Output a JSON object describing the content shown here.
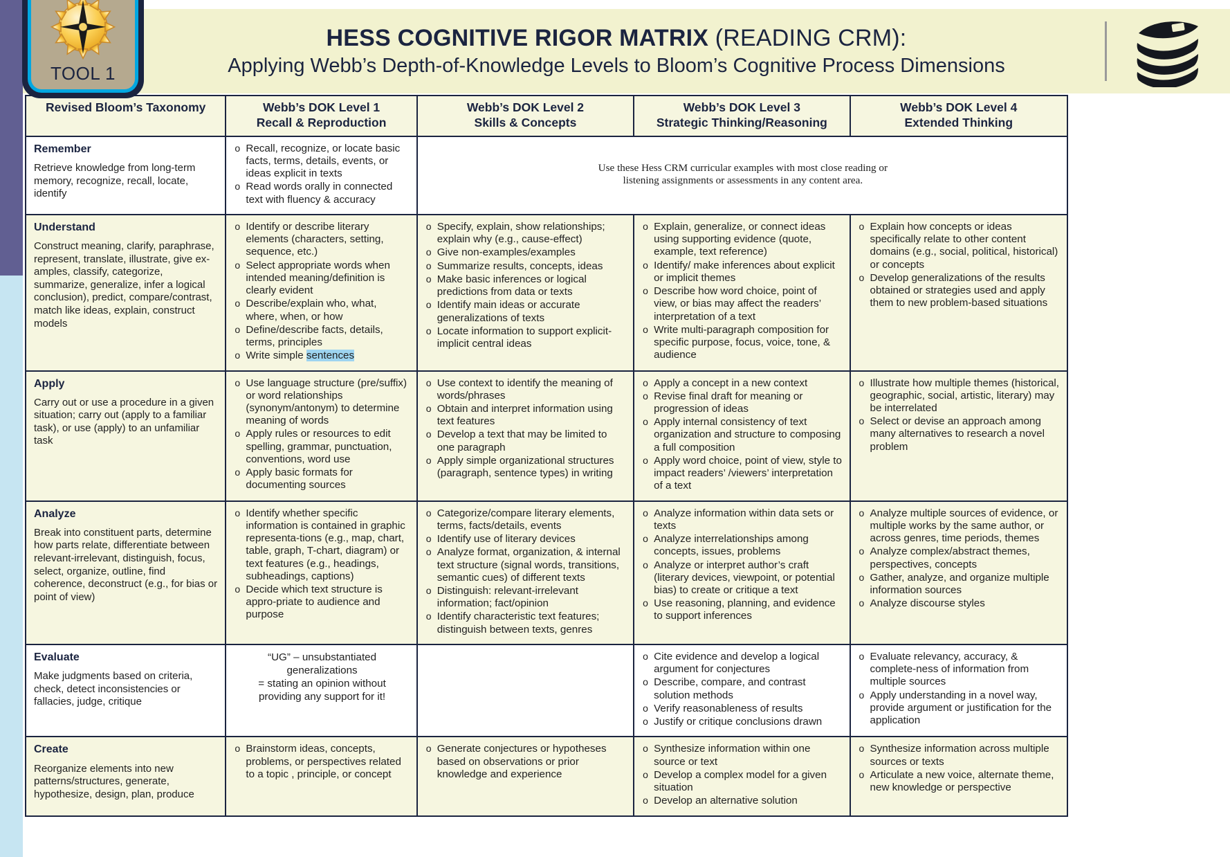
{
  "badge": {
    "label": "TOOL 1",
    "icon": "compass-icon"
  },
  "header": {
    "title_bold": "HESS COGNITIVE RIGOR MATRIX ",
    "title_light": "(READING CRM):",
    "subtitle": "Applying Webb’s Depth-of-Knowledge Levels to Bloom’s Cognitive Process Dimensions",
    "icon": "book-stack-icon",
    "bg_color": "#f2f2cf",
    "text_color": "#1b2440"
  },
  "columns": [
    {
      "title": "Revised Bloom’s Taxonomy",
      "sub": ""
    },
    {
      "title": "Webb’s DOK Level 1",
      "sub": "Recall & Reproduction"
    },
    {
      "title": "Webb’s DOK Level 2",
      "sub": "Skills & Concepts"
    },
    {
      "title": "Webb’s DOK Level 3",
      "sub": "Strategic Thinking/Reasoning"
    },
    {
      "title": "Webb’s DOK Level 4",
      "sub": "Extended Thinking"
    }
  ],
  "banner": {
    "line1": "Use these Hess CRM curricular examples with most close reading or",
    "line2": "listening assignments or assessments in any content area.",
    "bg_color": "#fbe97a"
  },
  "rows": {
    "remember": {
      "name": "Remember",
      "desc": "Retrieve knowledge from long-term memory, recognize, recall, locate, identify",
      "dok1": [
        "Recall, recognize, or locate basic facts, terms, details, events, or ideas explicit in texts",
        "Read words orally in connected text with fluency & accuracy"
      ]
    },
    "understand": {
      "name": "Understand",
      "desc": "Construct meaning, clarify, paraphrase, represent, translate, illustrate, give ex-amples, classify, categorize, summarize, generalize, infer a logical conclusion), predict, compare/contrast, match like ideas, explain, construct models",
      "dok1": [
        "Identify or describe literary elements (characters, setting, sequence, etc.)",
        "Select appropriate words when intended meaning/definition is clearly evident",
        "Describe/explain who, what, where, when, or how",
        "Define/describe facts, details, terms, principles",
        "Write simple sentences"
      ],
      "dok1_highlight": "sentences",
      "dok2": [
        "Specify, explain, show relationships; explain why (e.g., cause-effect)",
        "Give non-examples/examples",
        "Summarize results, concepts, ideas",
        "Make basic inferences or logical predictions from data or texts",
        "Identify main ideas or accurate generalizations of texts",
        "Locate information to support explicit-implicit central ideas"
      ],
      "dok3": [
        "Explain, generalize, or connect ideas using supporting evidence (quote, example, text reference)",
        "Identify/ make inferences about explicit or implicit themes",
        "Describe how  word choice, point of view, or bias may affect the readers’ interpretation of a text",
        "Write multi-paragraph  composition for specific purpose, focus, voice, tone, & audience"
      ],
      "dok4": [
        "Explain how concepts or ideas specifically relate to other content domains (e.g., social, political, historical) or concepts",
        "Develop generalizations of the results obtained or strategies used and apply them to new problem-based situations"
      ]
    },
    "apply": {
      "name": "Apply",
      "desc": "Carry out or use a procedure in a given situation; carry out (apply to a familiar task), or use (apply) to an unfamiliar task",
      "dok1": [
        "Use language structure (pre/suffix) or word relationships (synonym/antonym) to determine meaning of words",
        "Apply rules or resources to edit spelling, grammar, punctuation, conventions, word use",
        "Apply basic formats for documenting sources"
      ],
      "dok2": [
        "Use context to identify the meaning of words/phrases",
        "Obtain and interpret information using text features",
        "Develop a text that may be limited to one paragraph",
        "Apply simple organizational structures (paragraph, sentence types) in writing"
      ],
      "dok3": [
        "Apply a concept in a new context",
        "Revise final draft for meaning or progression of ideas",
        "Apply internal consistency of text organization and structure to composing a full composition",
        "Apply word choice, point of view, style to impact readers’ /viewers’ interpretation of a text"
      ],
      "dok4": [
        "Illustrate how multiple themes (historical, geographic, social, artistic, literary)  may be interrelated",
        "Select or devise an approach among many alternatives to research a novel problem"
      ]
    },
    "analyze": {
      "name": "Analyze",
      "desc": "Break into constituent parts, determine how parts relate, differentiate between relevant-irrelevant, distinguish, focus, select, organize, outline, find coherence, deconstruct (e.g., for bias or point of view)",
      "dok1": [
        "Identify whether specific information is contained in graphic representa-tions (e.g., map, chart, table, graph, T-chart, diagram) or text features (e.g., headings, subheadings, captions)",
        "Decide which text structure is appro-priate to audience and purpose"
      ],
      "dok2": [
        "Categorize/compare literary elements, terms, facts/details, events",
        "Identify use of literary devices",
        "Analyze format, organization, & internal text structure (signal words, transitions, semantic cues) of different texts",
        "Distinguish: relevant-irrelevant information; fact/opinion",
        "Identify characteristic text features; distinguish between texts, genres"
      ],
      "dok3": [
        "Analyze information within data sets or texts",
        "Analyze interrelationships among concepts, issues, problems",
        "Analyze or interpret author’s craft (literary devices, viewpoint, or potential  bias) to create or critique a text",
        "Use reasoning, planning, and evidence to support inferences"
      ],
      "dok4": [
        "Analyze multiple sources of evidence, or multiple works by the same author, or across genres, time periods, themes",
        "Analyze complex/abstract themes, perspectives, concepts",
        "Gather, analyze, and organize multiple information sources",
        "Analyze discourse styles"
      ]
    },
    "evaluate": {
      "name": "Evaluate",
      "desc": "Make judgments based on criteria, check, detect inconsistencies or fallacies, judge, critique",
      "dok1_note_l1": "“UG” – unsubstantiated generalizations",
      "dok1_note_l2": "= stating an opinion without",
      "dok1_note_l3": "providing any support for it!",
      "dok2": [],
      "dok3": [
        "Cite evidence and develop a logical argument for conjectures",
        "Describe, compare, and contrast solution methods",
        "Verify reasonableness of results",
        "Justify or critique  conclusions drawn"
      ],
      "dok4": [
        "Evaluate relevancy, accuracy, & complete-ness of information from multiple sources",
        "Apply understanding in a novel way, provide argument or justification for the application"
      ]
    },
    "create": {
      "name": "Create",
      "desc": "Reorganize elements into new patterns/structures, generate, hypothesize, design, plan, produce",
      "dok1": [
        "Brainstorm ideas, concepts, problems, or perspectives related to a topic , principle, or concept"
      ],
      "dok2": [
        "Generate conjectures or hypotheses based on observations or prior knowledge and experience"
      ],
      "dok3": [
        "Synthesize information within one source or text",
        "Develop a complex model for a given situation",
        "Develop an alternative solution"
      ],
      "dok4": [
        "Synthesize information across multiple sources or texts",
        "Articulate a new voice, alternate theme, new knowledge or perspective"
      ]
    }
  }
}
